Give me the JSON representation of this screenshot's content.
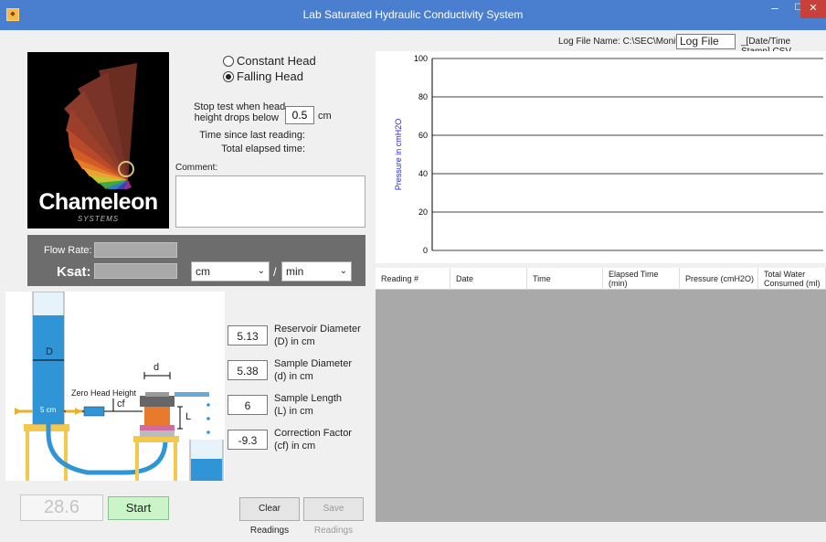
{
  "titlebar": {
    "title": "Lab Saturated Hydraulic Conductivity System",
    "min": "–",
    "max": "☐",
    "close": "✕",
    "icon": "app-icon"
  },
  "logo": {
    "brand": "Chameleon",
    "sub": "SYSTEMS"
  },
  "mode": {
    "options": [
      "Constant Head",
      "Falling Head"
    ],
    "selected": "Falling Head"
  },
  "stop": {
    "label_line1": "Stop test when head",
    "label_line2": "height drops below",
    "value": "0.5",
    "unit": "cm"
  },
  "timing": {
    "since_last": "Time since last reading:",
    "elapsed": "Total elapsed time:"
  },
  "comment": {
    "label": "Comment:",
    "value": ""
  },
  "flow": {
    "flow_label": "Flow Rate:",
    "ksat_label": "Ksat:",
    "length_unit": "cm",
    "separator": "/",
    "time_unit": "min"
  },
  "diagram": {
    "D": "D",
    "d": "d",
    "L": "L",
    "cf": "cf",
    "zero_head": "Zero Head Height",
    "five_cm": "5 cm"
  },
  "params": [
    {
      "value": "5.13",
      "line1": "Reservoir Diameter",
      "line2": "(D) in cm"
    },
    {
      "value": "5.38",
      "line1": "Sample Diameter",
      "line2": "(d) in cm"
    },
    {
      "value": "6",
      "line1": "Sample Length",
      "line2": "(L) in cm"
    },
    {
      "value": "-9.3",
      "line1": "Correction Factor",
      "line2": "(cf) in cm"
    }
  ],
  "footer": {
    "counter": "28.6",
    "start": "Start",
    "clear": "Clear Readings",
    "save": "Save Readings"
  },
  "logfile": {
    "label": "Log File Name:  C:\\SEC\\Monitor\\",
    "value": "Log File",
    "suffix": "_[Date/Time Stamp].CSV"
  },
  "chart_data": {
    "type": "line",
    "title": "",
    "xlabel": "",
    "ylabel": "Pressure in cmH2O",
    "ylim": [
      0,
      100
    ],
    "yticks": [
      0,
      20,
      40,
      60,
      80,
      100
    ],
    "grid": true,
    "series": [],
    "colors": {
      "axis": "#000000",
      "grid": "#000000",
      "ylabel": "#2b2bd6"
    }
  },
  "table": {
    "columns": [
      [
        "Reading #"
      ],
      [
        "Date"
      ],
      [
        "Time"
      ],
      [
        "Elapsed Time",
        "(min)"
      ],
      [
        "Pressure (cmH2O)"
      ],
      [
        "Total Water",
        "Consumed (ml)"
      ]
    ],
    "rows": []
  }
}
